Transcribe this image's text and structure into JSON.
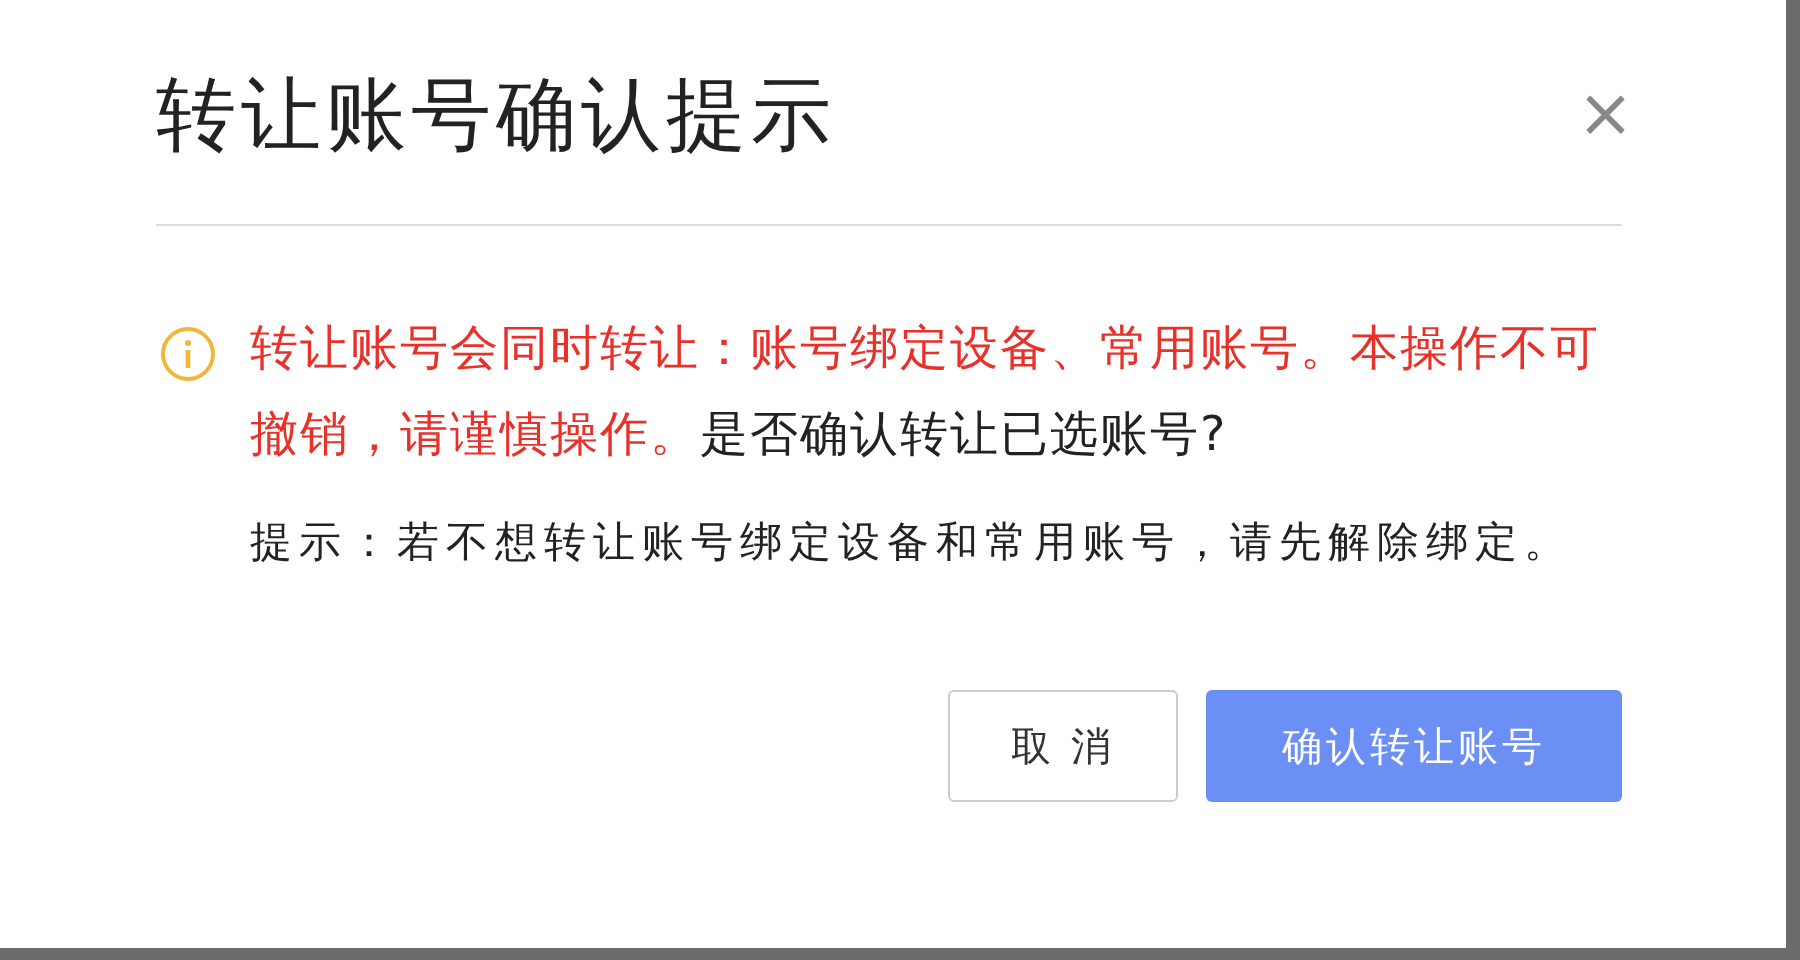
{
  "dialog": {
    "title": "转让账号确认提示",
    "close": "×",
    "warning": [
      {
        "text": "转让账号会同时转让：账号绑定设备、常用账号。本操作不可撤销，请谨慎操作。",
        "emphasis": true
      },
      {
        "text": "是否确认转让已选账号?",
        "emphasis": false
      }
    ],
    "hint": "提示：若不想转让账号绑定设备和常用账号，请先解除绑定。",
    "buttons": [
      {
        "label": "取 消",
        "kind": "secondary"
      },
      {
        "label": "确认转让账号",
        "kind": "primary"
      }
    ]
  }
}
